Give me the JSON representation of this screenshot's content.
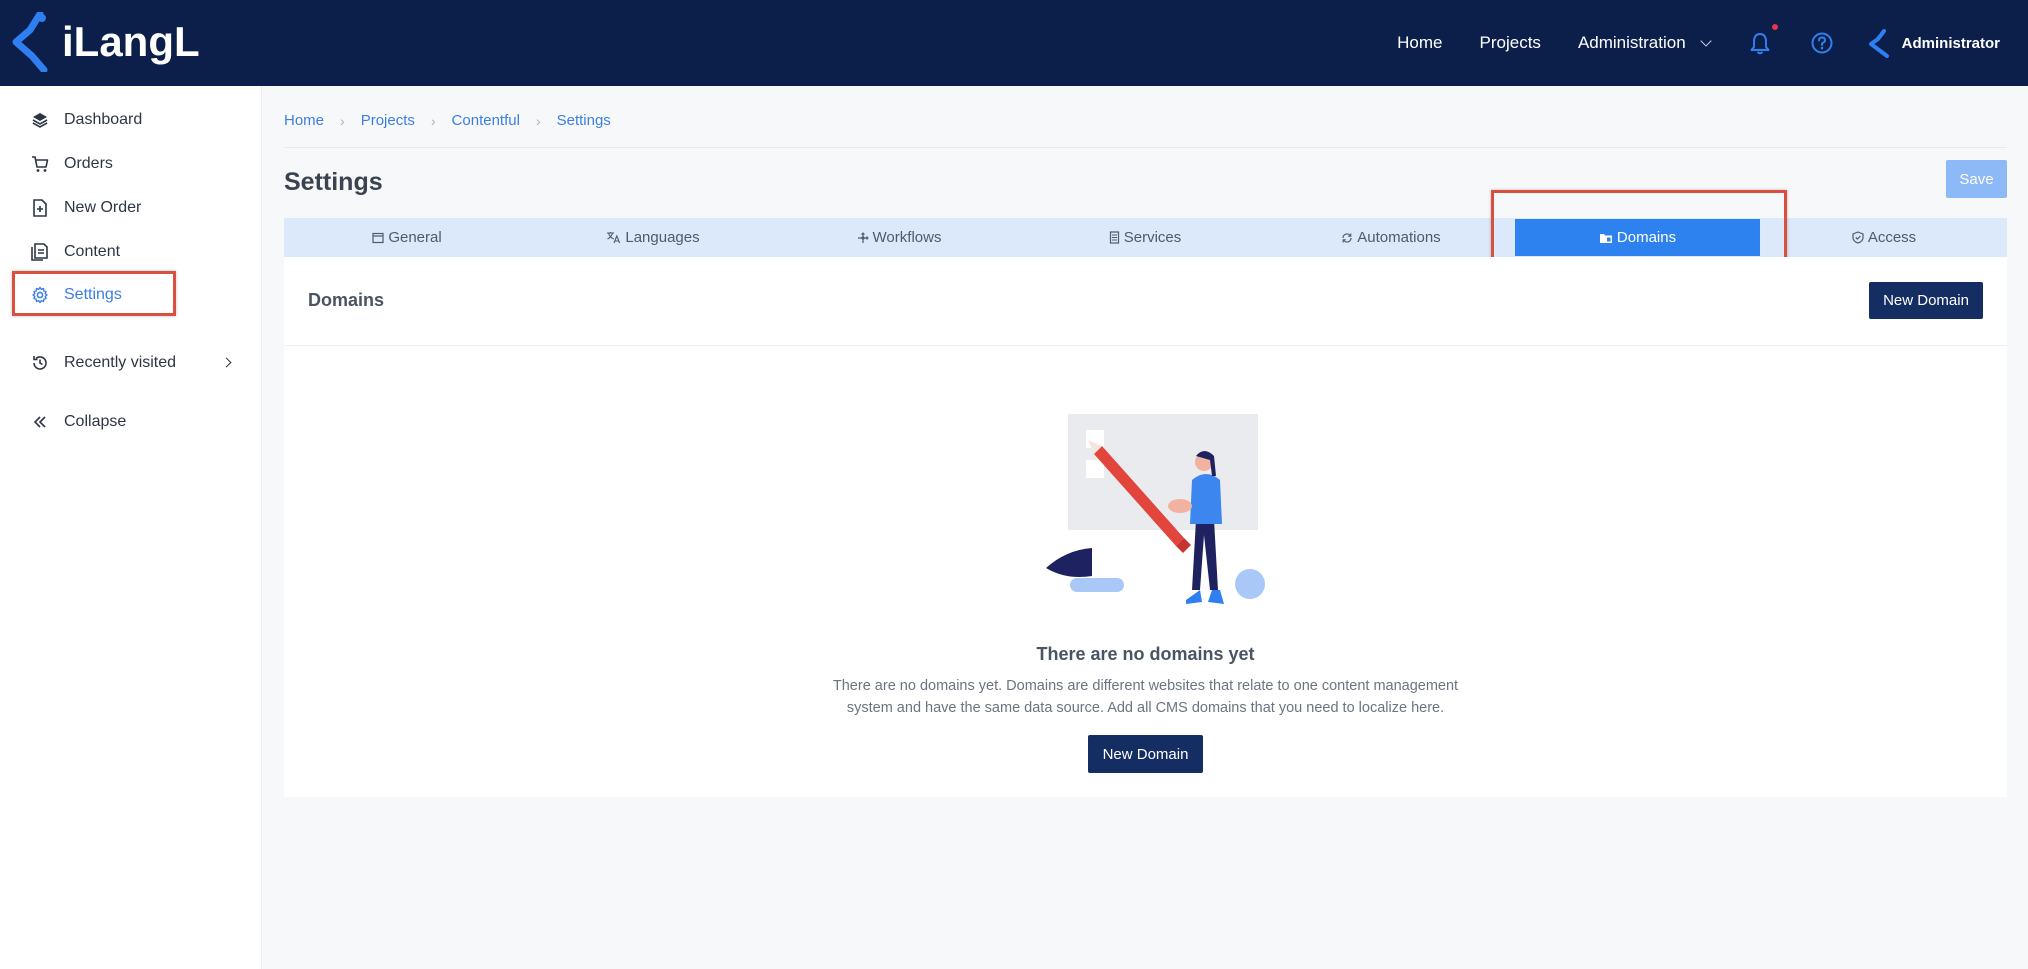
{
  "app": {
    "logo_text": "iLangL"
  },
  "topnav": {
    "home": "Home",
    "projects": "Projects",
    "administration": "Administration",
    "user": "Administrator"
  },
  "sidebar": {
    "items": [
      {
        "label": "Dashboard",
        "icon": "layers-icon"
      },
      {
        "label": "Orders",
        "icon": "cart-icon"
      },
      {
        "label": "New Order",
        "icon": "file-plus-icon"
      },
      {
        "label": "Content",
        "icon": "documents-icon"
      },
      {
        "label": "Settings",
        "icon": "gear-icon",
        "active": true
      },
      {
        "label": "Recently visited",
        "icon": "history-icon"
      },
      {
        "label": "Collapse",
        "icon": "double-chevron-left-icon"
      }
    ]
  },
  "breadcrumb": [
    "Home",
    "Projects",
    "Contentful",
    "Settings"
  ],
  "page": {
    "title": "Settings",
    "save_label": "Save"
  },
  "tabs": [
    {
      "label": "General",
      "icon": "window-icon"
    },
    {
      "label": "Languages",
      "icon": "translate-icon"
    },
    {
      "label": "Workflows",
      "icon": "workflow-icon"
    },
    {
      "label": "Services",
      "icon": "server-icon"
    },
    {
      "label": "Automations",
      "icon": "sync-icon"
    },
    {
      "label": "Domains",
      "icon": "folder-icon",
      "active": true
    },
    {
      "label": "Access",
      "icon": "shield-check-icon"
    }
  ],
  "panel": {
    "title": "Domains",
    "new_domain_label": "New Domain",
    "empty_title": "There are no domains yet",
    "empty_desc": "There are no domains yet. Domains are different websites that relate to one content management system and have the same data source. Add all CMS domains that you need to localize here.",
    "empty_button_label": "New Domain"
  },
  "colors": {
    "topbar": "#0c1f4a",
    "accent": "#2d82f0",
    "link": "#3c7ee6",
    "primary_button": "#142e63",
    "highlight_box": "#d9503f"
  }
}
